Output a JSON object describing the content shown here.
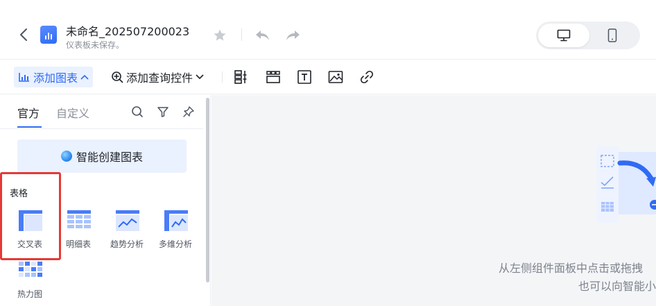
{
  "header": {
    "title": "未命名_202507200023",
    "subtitle": "仪表板未保存。",
    "icons": [
      "back-icon",
      "dashboard-chart-icon",
      "star-icon",
      "undo-icon",
      "redo-icon"
    ],
    "device_toggle": {
      "selected": "desktop",
      "options": [
        "desktop-icon",
        "mobile-icon"
      ]
    }
  },
  "toolbar": {
    "add_chart_label": "添加图表",
    "add_query_label": "添加查询控件",
    "icons": [
      "layout-icon",
      "tab-container-icon",
      "text-icon",
      "image-icon",
      "link-icon"
    ]
  },
  "left_panel": {
    "tabs": [
      {
        "label": "官方",
        "active": true
      },
      {
        "label": "自定义",
        "active": false
      }
    ],
    "panel_icons": [
      "search-icon",
      "filter-icon",
      "pin-icon"
    ],
    "smart_button_label": "智能创建图表",
    "section_label": "表格",
    "chart_types": [
      {
        "label": "交叉表",
        "icon": "crosstab-icon"
      },
      {
        "label": "明细表",
        "icon": "detail-table-icon"
      },
      {
        "label": "趋势分析",
        "icon": "trend-analysis-icon"
      },
      {
        "label": "多维分析",
        "icon": "multidim-analysis-icon"
      },
      {
        "label": "热力图",
        "icon": "heatmap-icon"
      }
    ]
  },
  "canvas": {
    "empty_line1": "从左侧组件面板中点击或拖拽",
    "empty_line2": "也可以向智能小"
  },
  "colors": {
    "accent": "#2f6bf4",
    "accent_light": "#eaf1ff",
    "highlight_box": "#e53935",
    "canvas_bg": "#f4f5f7"
  }
}
